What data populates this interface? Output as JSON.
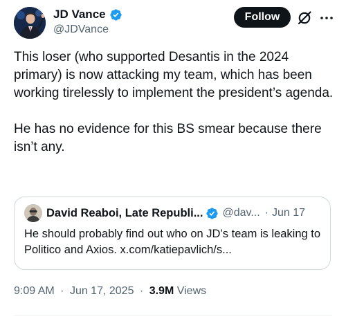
{
  "author": {
    "display_name": "JD Vance",
    "handle": "@JDVance",
    "verified": true,
    "avatar_icon": "profile-photo"
  },
  "actions": {
    "follow_label": "Follow",
    "grok_icon": "grok-icon",
    "more_icon": "more-options-icon"
  },
  "tweet": {
    "paragraphs": [
      "This loser (who supported Desantis  in the 2024 primary) is now attacking my team, which has been working tirelessly to implement the president’s agenda.",
      "He has no evidence for this BS smear because there isn’t any."
    ]
  },
  "quoted_tweet": {
    "display_name": "David Reaboi, Late Republi...",
    "handle": "@dav...",
    "separator": "·",
    "date": "Jun 17",
    "verified": true,
    "text": "He should probably find out who on JD’s team is leaking to Politico and Axios. x.com/katiepavlich/s..."
  },
  "meta": {
    "time": "9:09 AM",
    "separator": "·",
    "date": "Jun 17, 2025",
    "views_count": "3.9M",
    "views_label": "Views"
  },
  "colors": {
    "text_primary": "#0f1419",
    "text_secondary": "#536471",
    "verified_blue": "#1d9bf0",
    "follow_bg": "#0f1419",
    "border": "#cfd9de"
  }
}
